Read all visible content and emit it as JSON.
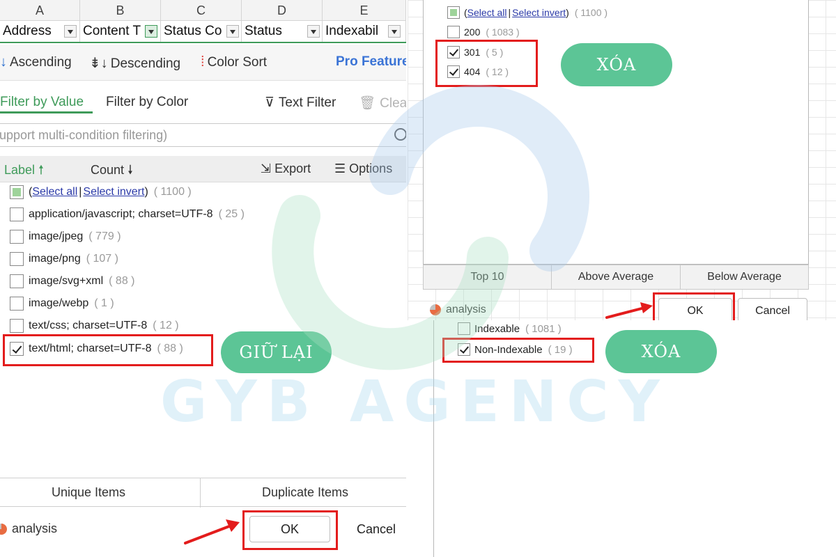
{
  "left": {
    "column_letters": [
      "A",
      "B",
      "C",
      "D",
      "E"
    ],
    "column_headers": [
      "Address",
      "Content T",
      "Status Co",
      "Status",
      "Indexabil"
    ],
    "sort": {
      "ascending": "Ascending",
      "descending": "Descending",
      "color_sort": "Color Sort",
      "pro": "Pro Feature"
    },
    "filter_tabs": {
      "by_value": "Filter by Value",
      "by_color": "Filter by Color",
      "text_filter": "Text Filter",
      "clear": "Clea"
    },
    "search_placeholder": "upport multi-condition filtering)",
    "list_header": {
      "label": "Label",
      "count": "Count",
      "export": "Export",
      "options": "Options"
    },
    "select_all": {
      "open": "(",
      "all": "Select all",
      "sep": "|",
      "invert": "Select invert",
      "close": ")",
      "count": "( 1100 )"
    },
    "items": [
      {
        "label": "application/javascript; charset=UTF-8",
        "count": "( 25 )",
        "checked": false
      },
      {
        "label": "image/jpeg",
        "count": "( 779 )",
        "checked": false
      },
      {
        "label": "image/png",
        "count": "( 107 )",
        "checked": false
      },
      {
        "label": "image/svg+xml",
        "count": "( 88 )",
        "checked": false
      },
      {
        "label": "image/webp",
        "count": "( 1 )",
        "checked": false
      },
      {
        "label": "text/css; charset=UTF-8",
        "count": "( 12 )",
        "checked": false
      },
      {
        "label": "text/html; charset=UTF-8",
        "count": "( 88 )",
        "checked": true
      }
    ],
    "badge": "GIỮ LẠI",
    "bottom_tabs": {
      "unique": "Unique Items",
      "duplicate": "Duplicate Items"
    },
    "analysis": "analysis",
    "ok": "OK",
    "cancel": "Cancel"
  },
  "right_top": {
    "select_all": {
      "open": "(",
      "all": "Select all",
      "sep": "|",
      "invert": "Select invert",
      "close": ")",
      "count": "( 1100 )"
    },
    "items": [
      {
        "label": "200",
        "count": "( 1083 )",
        "checked": false
      },
      {
        "label": "301",
        "count": "( 5 )",
        "checked": true
      },
      {
        "label": "404",
        "count": "( 12 )",
        "checked": true
      }
    ],
    "badge": "XÓA",
    "top_buttons": {
      "top10": "Top 10",
      "above": "Above Average",
      "below": "Below Average"
    },
    "analysis": "analysis",
    "ok": "OK",
    "cancel": "Cancel"
  },
  "right_bottom": {
    "items": [
      {
        "label": "Indexable",
        "count": "( 1081 )",
        "checked": false
      },
      {
        "label": "Non-Indexable",
        "count": "( 19 )",
        "checked": true
      }
    ],
    "badge": "XÓA"
  },
  "watermark": "GYB AGENCY",
  "colors": {
    "accent_green": "#3f9b5a",
    "badge_green": "#5cc596",
    "highlight_red": "#e31c1c",
    "link_blue": "#2b3aa8",
    "pro_blue": "#3b74d6"
  },
  "icons": [
    "sort-ascending-icon",
    "sort-descending-icon",
    "color-sort-icon",
    "text-filter-icon",
    "trash-icon",
    "search-icon",
    "export-icon",
    "options-icon",
    "pie-chart-icon",
    "arrow-icon"
  ]
}
